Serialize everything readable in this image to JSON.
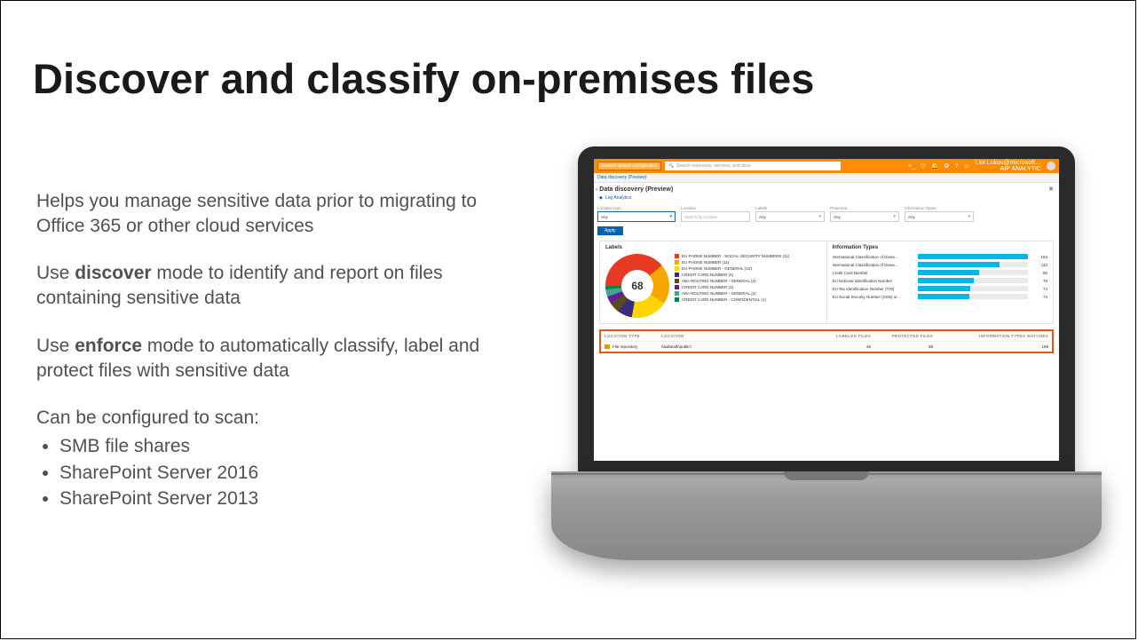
{
  "title": "Discover and classify on-premises files",
  "body": {
    "p1": "Helps you manage sensitive data prior to migrating to Office 365 or other cloud services",
    "p2_pre": "Use ",
    "p2_b": "discover",
    "p2_post": " mode to identify and report on files containing sensitive data",
    "p3_pre": "Use ",
    "p3_b": "enforce",
    "p3_post": " mode to automatically classify, label and protect files with sensitive data",
    "p4_intro": "Can be configured to scan:",
    "scan_items": [
      "SMB file shares",
      "SharePoint Server 2016",
      "SharePoint Server 2013"
    ]
  },
  "azure": {
    "restore_label": "Restore default configuration",
    "search_icon": "🔍",
    "search_placeholder": "Search resources, services, and docs",
    "user_name": "Lior.Lukov@microsoft…",
    "user_role": "AIP ANALYTIC",
    "breadcrumb": "Data discovery (Preview)",
    "blade_title": "- Data discovery (Preview)",
    "log_link": "Log Analytics",
    "filters": {
      "f1_label": "Location type",
      "f1_value": "Any",
      "f2_label": "Location",
      "f2_placeholder": "Search by location",
      "f3_label": "Labels",
      "f3_value": "Any",
      "f4_label": "Protected",
      "f4_value": "Any",
      "f5_label": "Information Types",
      "f5_value": "Any",
      "apply": "Apply"
    },
    "labels_panel_title": "Labels",
    "info_panel_title": "Information Types",
    "donut_center": "68",
    "legend": [
      {
        "name": "EU PHONE NUMBER - SOCIAL SECURITY NUMBERS (21)",
        "color": "#e83a22"
      },
      {
        "name": "EU PHONE NUMBER (11)",
        "color": "#f7a600"
      },
      {
        "name": "EU PHONE NUMBER - GENERAL (10)",
        "color": "#ffd400"
      },
      {
        "name": "CREDIT CARD NUMBER (4)",
        "color": "#3a2e7a"
      },
      {
        "name": "ABA ROUTING NUMBER - GENERAL (3)",
        "color": "#5b4a1f"
      },
      {
        "name": "CREDIT CARD NUMBER (2)",
        "color": "#6a1b9a"
      },
      {
        "name": "ABA ROUTING NUMBER - GENERAL (2)",
        "color": "#3fa796"
      },
      {
        "name": "CREDIT CARD NUMBER - CONFIDENTIAL (1)",
        "color": "#0b8043"
      }
    ],
    "info_types": [
      {
        "label": "International Classification of Disea…",
        "value": 153,
        "pct": 100
      },
      {
        "label": "International Classification of Disea…",
        "value": 113,
        "pct": 74
      },
      {
        "label": "Credit Card Number",
        "value": 86,
        "pct": 56
      },
      {
        "label": "EU National Identification Number",
        "value": 78,
        "pct": 51
      },
      {
        "label": "EU Tax Identification Number (TIN)",
        "value": 74,
        "pct": 48
      },
      {
        "label": "EU Social Security Number (SSN) or…",
        "value": 73,
        "pct": 47
      }
    ],
    "table": {
      "headers": [
        "LOCATION TYPE",
        "LOCATION",
        "",
        "LABELED FILES",
        "PROTECTED FILES",
        "INFORMATION TYPES MATCHES"
      ],
      "row": {
        "type": "File repository",
        "location": "\\\\aidlandlr\\public\\",
        "labeled": "46",
        "protected": "58",
        "matches": "159"
      }
    }
  },
  "chart_data": [
    {
      "type": "pie",
      "title": "Labels",
      "total_label": "68",
      "series": [
        {
          "name": "EU PHONE NUMBER - SOCIAL SECURITY NUMBERS",
          "value": 21,
          "color": "#e83a22"
        },
        {
          "name": "EU PHONE NUMBER",
          "value": 11,
          "color": "#f7a600"
        },
        {
          "name": "EU PHONE NUMBER - GENERAL",
          "value": 10,
          "color": "#ffd400"
        },
        {
          "name": "CREDIT CARD NUMBER",
          "value": 4,
          "color": "#3a2e7a"
        },
        {
          "name": "ABA ROUTING NUMBER - GENERAL",
          "value": 3,
          "color": "#5b4a1f"
        },
        {
          "name": "CREDIT CARD NUMBER",
          "value": 2,
          "color": "#6a1b9a"
        },
        {
          "name": "ABA ROUTING NUMBER - GENERAL",
          "value": 2,
          "color": "#3fa796"
        },
        {
          "name": "CREDIT CARD NUMBER - CONFIDENTIAL",
          "value": 1,
          "color": "#0b8043"
        }
      ]
    },
    {
      "type": "bar",
      "title": "Information Types",
      "categories": [
        "International Classification of Diseases (A)",
        "International Classification of Diseases (B)",
        "Credit Card Number",
        "EU National Identification Number",
        "EU Tax Identification Number (TIN)",
        "EU Social Security Number (SSN)"
      ],
      "values": [
        153,
        113,
        86,
        78,
        74,
        73
      ],
      "ylim": [
        0,
        160
      ]
    }
  ]
}
